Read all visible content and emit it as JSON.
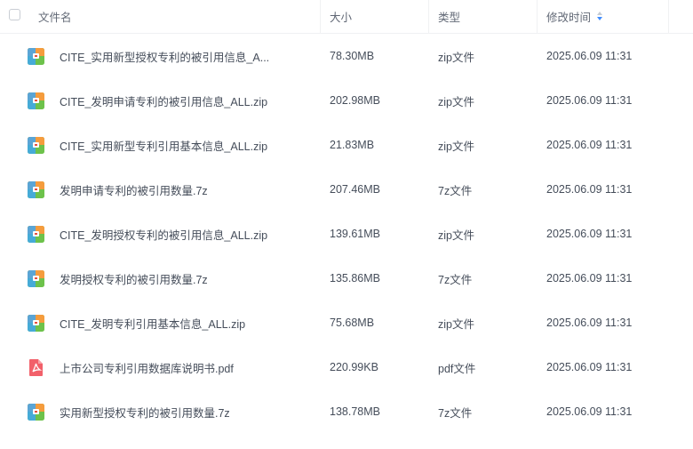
{
  "header": {
    "name": "文件名",
    "size": "大小",
    "type": "类型",
    "modified": "修改时间"
  },
  "files": [
    {
      "name": "CITE_实用新型授权专利的被引用信息_A...",
      "size": "78.30MB",
      "type": "zip文件",
      "time": "2025.06.09 11:31",
      "icon": "archive-icon"
    },
    {
      "name": "CITE_发明申请专利的被引用信息_ALL.zip",
      "size": "202.98MB",
      "type": "zip文件",
      "time": "2025.06.09 11:31",
      "icon": "archive-icon"
    },
    {
      "name": "CITE_实用新型专利引用基本信息_ALL.zip",
      "size": "21.83MB",
      "type": "zip文件",
      "time": "2025.06.09 11:31",
      "icon": "archive-icon"
    },
    {
      "name": "发明申请专利的被引用数量.7z",
      "size": "207.46MB",
      "type": "7z文件",
      "time": "2025.06.09 11:31",
      "icon": "archive-icon"
    },
    {
      "name": "CITE_发明授权专利的被引用信息_ALL.zip",
      "size": "139.61MB",
      "type": "zip文件",
      "time": "2025.06.09 11:31",
      "icon": "archive-icon"
    },
    {
      "name": "发明授权专利的被引用数量.7z",
      "size": "135.86MB",
      "type": "7z文件",
      "time": "2025.06.09 11:31",
      "icon": "archive-icon"
    },
    {
      "name": "CITE_发明专利引用基本信息_ALL.zip",
      "size": "75.68MB",
      "type": "zip文件",
      "time": "2025.06.09 11:31",
      "icon": "archive-icon"
    },
    {
      "name": "上市公司专利引用数据库说明书.pdf",
      "size": "220.99KB",
      "type": "pdf文件",
      "time": "2025.06.09 11:31",
      "icon": "pdf-icon"
    },
    {
      "name": "实用新型授权专利的被引用数量.7z",
      "size": "138.78MB",
      "type": "7z文件",
      "time": "2025.06.09 11:31",
      "icon": "archive-icon"
    }
  ],
  "colors": {
    "archive_top": "#f59c3d",
    "archive_bottom": "#6dc24b",
    "archive_left": "#3fa7f0",
    "pdf": "#f2606a",
    "sort_active": "#3f8cff"
  }
}
